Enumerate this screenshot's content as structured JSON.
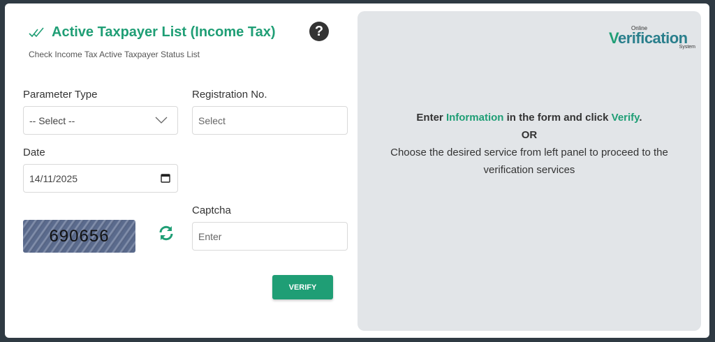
{
  "header": {
    "title": "Active Taxpayer List (Income Tax)",
    "subtitle": "Check Income Tax Active Taxpayer Status List",
    "help_glyph": "?"
  },
  "form": {
    "parameter_type": {
      "label": "Parameter Type",
      "value": "-- Select --"
    },
    "registration_no": {
      "label": "Registration No.",
      "placeholder": "Select"
    },
    "date": {
      "label": "Date",
      "value": "14/11/2025"
    },
    "captcha": {
      "label": "Captcha",
      "image_text": "690656",
      "placeholder": "Enter"
    },
    "verify_label": "VERIFY"
  },
  "panel": {
    "logo": {
      "online": "Online",
      "v": "V",
      "main": "erification",
      "system": "System"
    },
    "line1": {
      "prefix": "Enter ",
      "info_word": "Information",
      "middle": " in the form and click ",
      "verify_word": "Verify",
      "suffix": "."
    },
    "or": "OR",
    "line2": "Choose the desired service from left panel to proceed to the",
    "line3": "verification services"
  },
  "colors": {
    "accent": "#1f9e75",
    "panel_bg": "#e2e5e8",
    "page_bg": "#2f3a43"
  },
  "icons": [
    "double-check-icon",
    "help-icon",
    "chevron-down-icon",
    "calendar-icon",
    "refresh-icon"
  ]
}
